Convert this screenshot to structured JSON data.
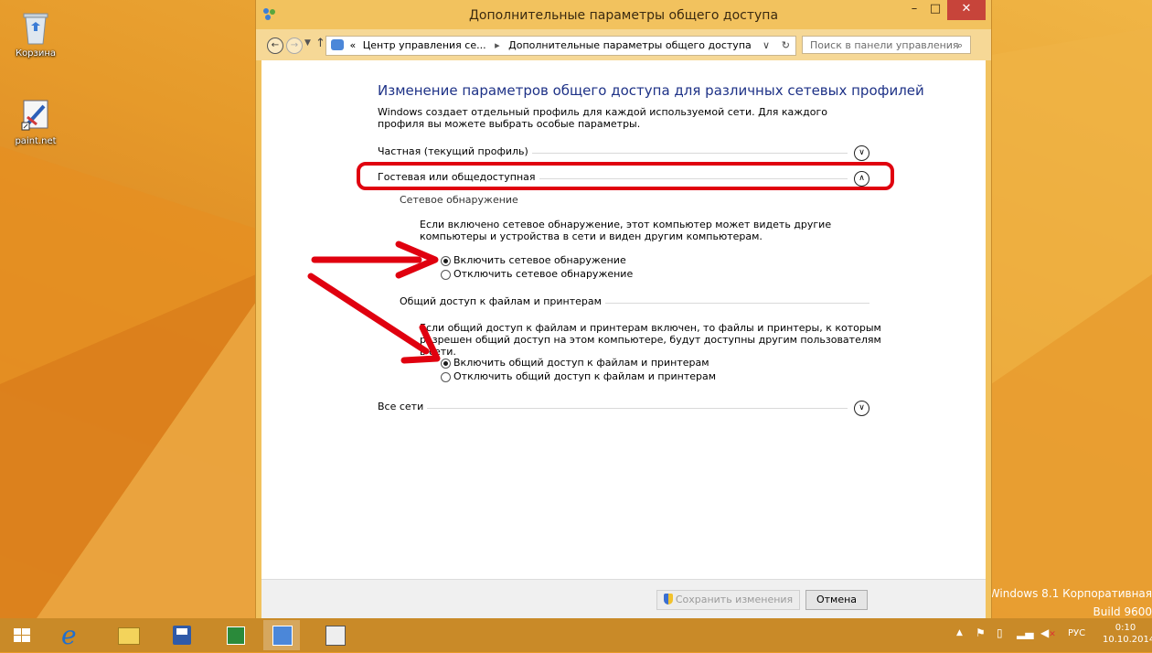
{
  "desktop": {
    "icons": [
      {
        "label": "Корзина"
      },
      {
        "label": "paint.net"
      }
    ],
    "watermark": {
      "line1": "Windows 8.1 Корпоративная",
      "line2": "Build 9600"
    }
  },
  "window": {
    "title": "Дополнительные параметры общего доступа",
    "controls": {
      "minimize": "–",
      "maximize": "□",
      "close": "✕"
    },
    "address": {
      "prefix": "«",
      "crumb1": "Центр управления се...",
      "separator": "▸",
      "crumb2": "Дополнительные параметры общего доступа"
    },
    "search": {
      "placeholder": "Поиск в панели управления"
    }
  },
  "page": {
    "heading": "Изменение параметров общего доступа для различных сетевых профилей",
    "description": "Windows создает отдельный профиль для каждой используемой сети. Для каждого профиля вы можете выбрать особые параметры.",
    "sections": {
      "private": "Частная (текущий профиль)",
      "guest": "Гостевая или общедоступная",
      "all": "Все сети"
    },
    "discovery": {
      "title": "Сетевое обнаружение",
      "desc": "Если включено сетевое обнаружение, этот компьютер может видеть другие компьютеры и устройства в сети и виден другим компьютерам.",
      "on": "Включить сетевое обнаружение",
      "off": "Отключить сетевое обнаружение"
    },
    "sharing": {
      "title": "Общий доступ к файлам и принтерам",
      "desc": "Если общий доступ к файлам и принтерам включен, то файлы и принтеры, к которым разрешен общий доступ на этом компьютере, будут доступны другим пользователям в сети.",
      "on": "Включить общий доступ к файлам и принтерам",
      "off": "Отключить общий доступ к файлам и принтерам"
    }
  },
  "footer": {
    "save": "Сохранить изменения",
    "cancel": "Отмена"
  },
  "taskbar": {
    "lang": "РУС",
    "time": "0:10",
    "date": "10.10.2014"
  },
  "colors": {
    "accent_heading": "#1e3287",
    "annotation_red": "#e0000f"
  }
}
